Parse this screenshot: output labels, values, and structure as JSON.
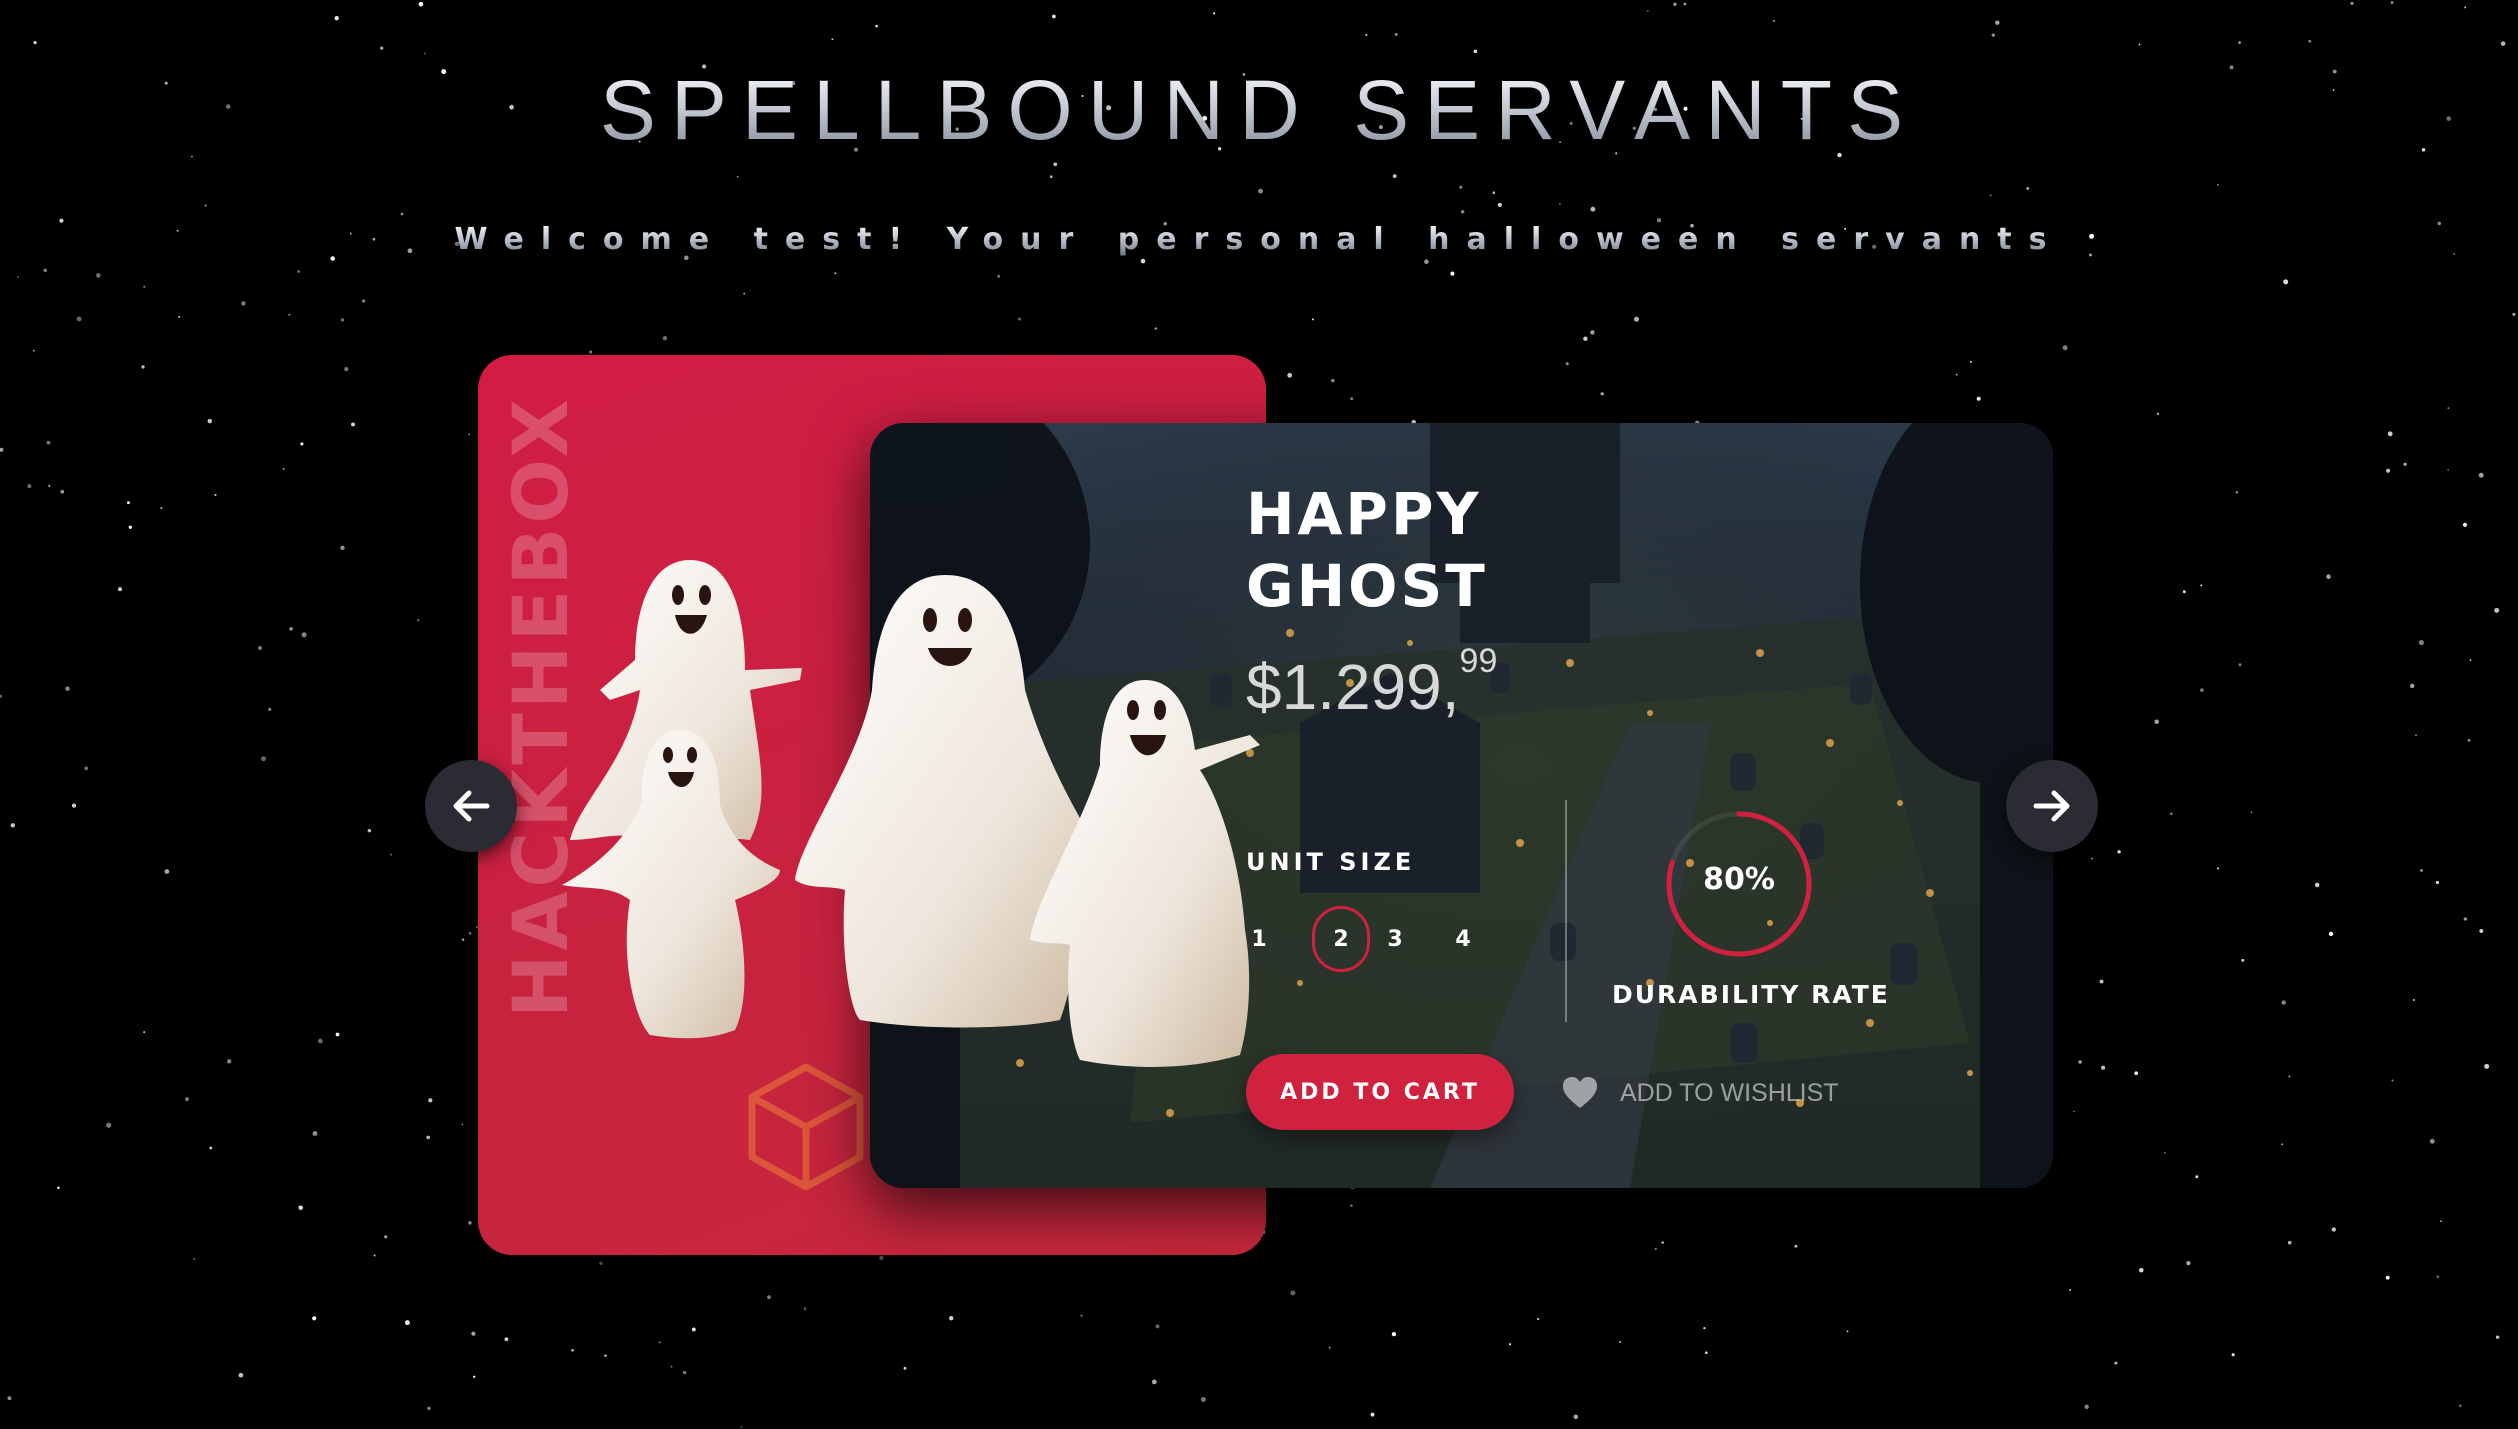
{
  "site": {
    "title": "SPELLBOUND SERVANTS",
    "welcome": "Welcome test! Your personal halloween servants"
  },
  "brand": {
    "watermark": "HACKTHEBOX",
    "logo_icon": "hexagon-cube-icon"
  },
  "product": {
    "name_line1": "HAPPY",
    "name_line2": "GHOST",
    "price_main": "$1.299,",
    "price_cents": "99",
    "unit_size_label": "UNIT SIZE",
    "sizes": [
      "1",
      "2",
      "3",
      "4"
    ],
    "selected_size": "2",
    "durability_value": "80%",
    "durability_fraction": 0.8,
    "durability_label": "DURABILITY RATE",
    "add_to_cart": "ADD TO CART",
    "add_to_wishlist": "ADD TO WISHLIST"
  },
  "navigation": {
    "prev_icon": "arrow-left-icon",
    "next_icon": "arrow-right-icon"
  },
  "colors": {
    "accent": "#d0213f",
    "card_red": "#cc2240",
    "background": "#000000",
    "nav_button": "#2b2b33"
  }
}
